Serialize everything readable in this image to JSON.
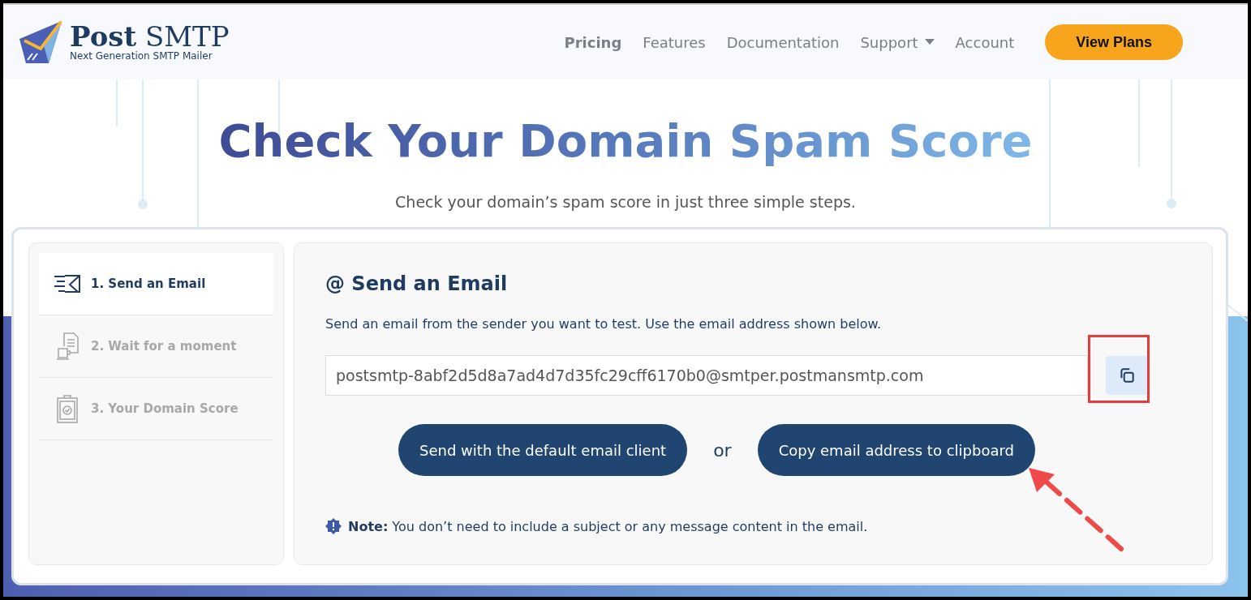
{
  "header": {
    "logo": {
      "title": "**Post** SMTP",
      "tagline": "Next Generation SMTP Mailer"
    },
    "nav": [
      {
        "label": "Pricing",
        "selected": true,
        "has_menu": false
      },
      {
        "label": "Features",
        "selected": false,
        "has_menu": false
      },
      {
        "label": "Documentation",
        "selected": false,
        "has_menu": false
      },
      {
        "label": "Support",
        "selected": false,
        "has_menu": true
      },
      {
        "label": "Account",
        "selected": false,
        "has_menu": false
      }
    ],
    "cta": "View Plans"
  },
  "hero": {
    "title": "Check Your Domain Spam Score",
    "subtitle": "Check your domain’s spam score in just three simple steps."
  },
  "steps": [
    {
      "label": "1. Send an Email",
      "kind": "send",
      "selected": true
    },
    {
      "label": "2. Wait for a moment",
      "kind": "wait",
      "selected": false
    },
    {
      "label": "3. Your Domain Score",
      "kind": "score",
      "selected": false
    }
  ],
  "panel": {
    "heading": "@ Send an Email",
    "instruction": "Send an email from the sender you want to test. Use the email address shown below.",
    "email": "postsmtp-8abf2d5d8a7ad4d7d35fc29cff6170b0@smtper.postmansmtp.com",
    "copy_highlighted": true,
    "buttons": [
      "Send with the default email client",
      "Copy email address to clipboard"
    ],
    "separator": "or",
    "note": "**Note:** You don’t need to include a subject or any message content in the email."
  }
}
